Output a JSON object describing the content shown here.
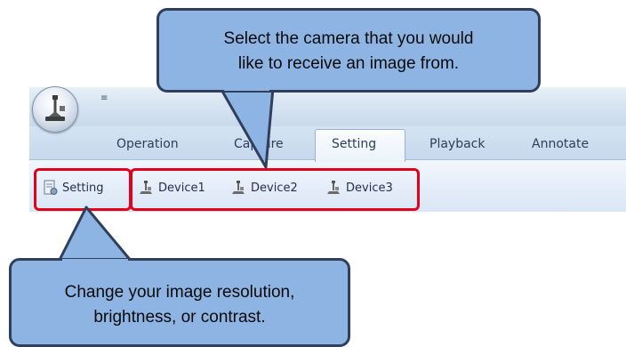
{
  "ribbon": {
    "quick_access_arrow": "≡",
    "tabs": [
      {
        "label": "Operation"
      },
      {
        "label": "Capture"
      },
      {
        "label": "Setting",
        "active": true
      },
      {
        "label": "Playback"
      },
      {
        "label": "Annotate"
      }
    ],
    "commands": [
      {
        "label": "Setting",
        "icon": "settings-document-icon"
      },
      {
        "label": "Device1",
        "icon": "camera-device-icon"
      },
      {
        "label": "Device2",
        "icon": "camera-device-icon"
      },
      {
        "label": "Device3",
        "icon": "camera-device-icon"
      }
    ]
  },
  "callouts": {
    "top": {
      "line1": "Select the camera that you would",
      "line2": "like to receive an image from."
    },
    "bottom": {
      "line1": "Change your image resolution,",
      "line2": "brightness, or contrast."
    }
  },
  "colors": {
    "callout_fill": "#8eb4e3",
    "callout_border": "#2f3f5c",
    "highlight": "#e2001a"
  }
}
